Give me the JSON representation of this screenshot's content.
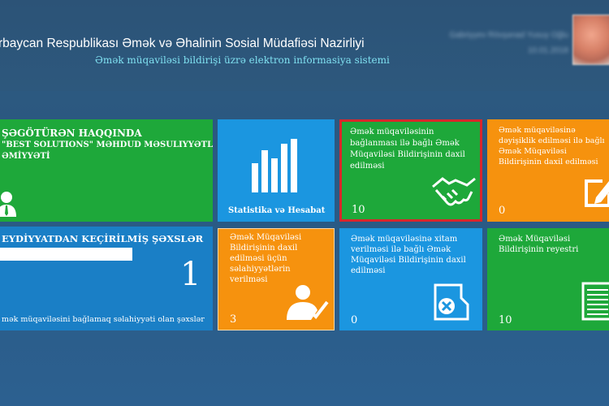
{
  "header": {
    "title": "rbaycan Respublikası Əmək və Əhalinin Sosial Müdafiəsi Nazirliyi",
    "subtitle": "Əmək müqaviləsi bildirişi üzrə elektron informasiya sistemi",
    "user_line1": "Gabriyyev Rövşənad Yusuy Oğlu",
    "user_line2": "10.01.2018"
  },
  "tiles": {
    "employer": {
      "heading": "ŞƏGÖTÜRƏN HAQQINDA",
      "name_line1": "\"BEST SOLUTIONS\" MƏHDUD MƏSULIYYƏTLİ",
      "name_line2": "ƏMİYYƏTİ"
    },
    "stats": {
      "label": "Statistika və Hesabat"
    },
    "contract_sign": {
      "label": "Əmək müqaviləsinin bağlanması ilə bağlı Əmək Müqaviləsi Bildirişinin daxil edilməsi",
      "count": "10"
    },
    "contract_change": {
      "label": "Əmək müqaviləsinə dəyişiklik edilməsi ilə bağlı Əmək Müqaviləsi Bildirişinin daxil edilməsi",
      "count": "0"
    },
    "registered": {
      "heading": "EYDİYYATDAN KEÇİRİLMİŞ ŞƏXSLƏR",
      "count": "1",
      "footer": "mək müqaviləsini bağlamaq səlahiyyəti olan şəxslər"
    },
    "authority": {
      "label": "Əmək Müqaviləsi Bildirişinin daxil edilməsi üçün səlahiyyətlərin verilməsi",
      "count": "3"
    },
    "contract_end": {
      "label": "Əmək müqaviləsinə xitam verilməsi ilə bağlı Əmək Müqaviləsi Bildirişinin daxil edilməsi",
      "count": "0"
    },
    "registry": {
      "label": "Əmək Müqaviləsi Bildirişinin reyestri",
      "count": "10"
    }
  },
  "colors": {
    "green": "#1ea83a",
    "blue": "#1b96e0",
    "orange": "#f6920e",
    "highlight": "#d9262b"
  },
  "icons": [
    "user-icon",
    "bar-chart-icon",
    "handshake-icon",
    "edit-icon",
    "user-check-icon",
    "document-delete-icon",
    "document-list-icon"
  ]
}
